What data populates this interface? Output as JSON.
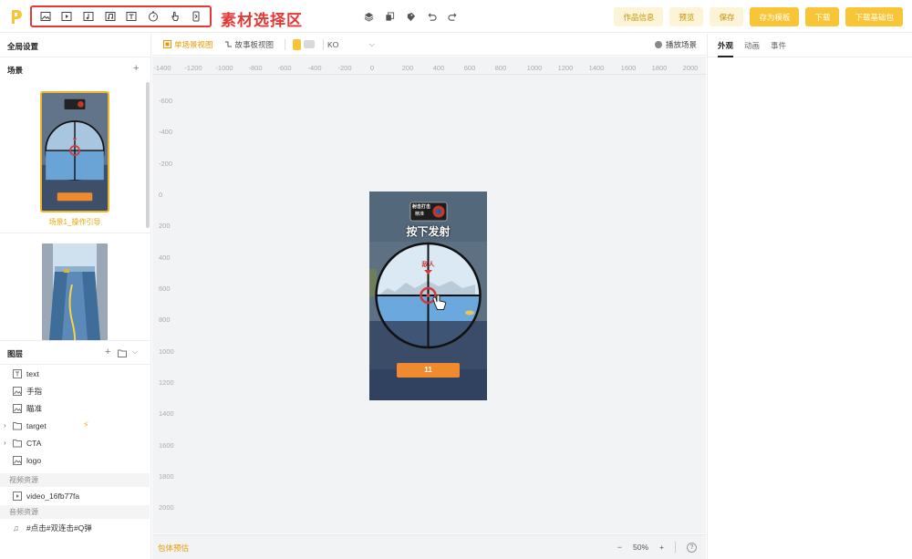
{
  "annotation": "素材选择区",
  "toolbar_tools": [
    "image-tool-icon",
    "video-tool-icon",
    "audio-tool-icon",
    "music-tool-icon",
    "text-tool-icon",
    "timer-tool-icon",
    "gesture-tool-icon",
    "device-tool-icon"
  ],
  "top_buttons": [
    {
      "label": "作品信息",
      "style": "light"
    },
    {
      "label": "预览",
      "style": "light"
    },
    {
      "label": "保存",
      "style": "light"
    },
    {
      "label": "存为模板",
      "style": "solid"
    },
    {
      "label": "下载",
      "style": "solid"
    },
    {
      "label": "下载基础包",
      "style": "solid"
    }
  ],
  "left": {
    "global_settings": "全局设置",
    "scene_title": "场景",
    "scene1_label": "场景1_操作引导",
    "scene_thumb": {
      "badge_title": "射击打击",
      "badge_sub": "精准",
      "press": "按下发射",
      "enemy": "敌人",
      "count": "11"
    },
    "layers_title": "图层",
    "layers": [
      {
        "name": "text",
        "icon": "text-icon",
        "folder": false
      },
      {
        "name": "手指",
        "icon": "image-icon",
        "folder": false
      },
      {
        "name": "瞄准",
        "icon": "image-icon",
        "folder": false
      },
      {
        "name": "target",
        "icon": "folder-icon",
        "folder": true,
        "bolt": true
      },
      {
        "name": "CTA",
        "icon": "folder-icon",
        "folder": true
      },
      {
        "name": "logo",
        "icon": "image-icon",
        "folder": false
      }
    ],
    "video_res_title": "视频资源",
    "video_item": "video_16fb77fa",
    "audio_res_title": "音频资源",
    "audio_item": "#点击#双连击#Q弹"
  },
  "canvas": {
    "tab_single": "单场景视图",
    "tab_story": "故事板视图",
    "lang": "KO",
    "play_label": "播放场景",
    "ruler_x": [
      "-1400",
      "-1200",
      "-1000",
      "-800",
      "-600",
      "-400",
      "-200",
      "0",
      "200",
      "400",
      "600",
      "800",
      "1000",
      "1200",
      "1400",
      "1600",
      "1800",
      "2000"
    ],
    "ruler_y": [
      "-600",
      "-400",
      "-200",
      "0",
      "200",
      "400",
      "600",
      "800",
      "1000",
      "1200",
      "1400",
      "1600",
      "1800",
      "2000"
    ],
    "phone": {
      "badge_title": "射击打击",
      "badge_sub": "精准",
      "press": "按下发射",
      "enemy": "敌人",
      "count": "11"
    },
    "bottom_left": "包体预估",
    "zoom_minus": "−",
    "zoom_value": "50%",
    "zoom_plus": "+",
    "help": "?"
  },
  "right": {
    "tabs": [
      "外观",
      "动画",
      "事件"
    ]
  },
  "colors": {
    "accent": "#f7c535",
    "red": "#e53935",
    "orange_btn": "#f08a2e"
  }
}
